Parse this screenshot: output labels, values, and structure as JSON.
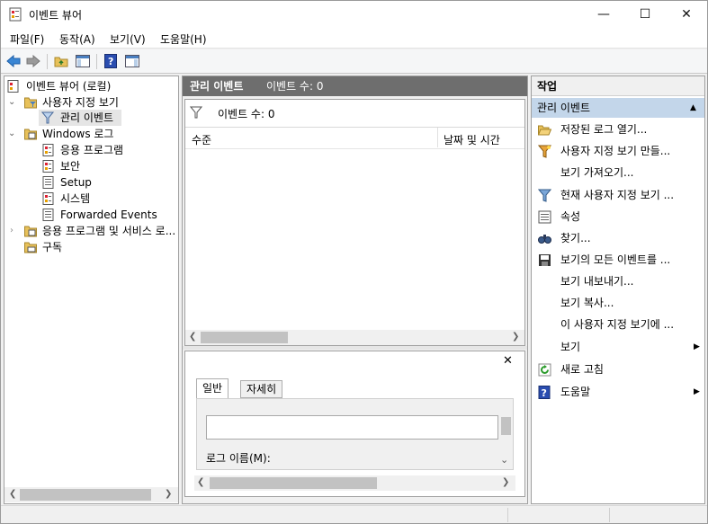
{
  "window": {
    "title": "이벤트 뷰어",
    "minimize": "—",
    "maximize": "☐",
    "close": "✕"
  },
  "menu": [
    "파일(F)",
    "동작(A)",
    "보기(V)",
    "도움말(H)"
  ],
  "tree": {
    "root": "이벤트 뷰어 (로컬)",
    "custom_views": "사용자 지정 보기",
    "admin_events": "관리 이벤트",
    "windows_logs": "Windows 로그",
    "logs": [
      "응용 프로그램",
      "보안",
      "Setup",
      "시스템",
      "Forwarded Events"
    ],
    "app_services": "응용 프로그램 및 서비스 로...",
    "subscriptions": "구독"
  },
  "center": {
    "header_title": "관리 이벤트",
    "header_count": "이벤트 수: 0",
    "filter_text": "이벤트 수: 0",
    "col_level": "수준",
    "col_date": "날짜 및 시간",
    "tab_general": "일반",
    "tab_details": "자세히",
    "log_name_label": "로그 이름(M):",
    "close_x": "✕"
  },
  "actions": {
    "header": "작업",
    "section": "관리 이벤트",
    "items": [
      {
        "label": "저장된 로그 열기...",
        "icon": "folder-open-icon"
      },
      {
        "label": "사용자 지정 보기 만들...",
        "icon": "filter-create-icon"
      },
      {
        "label": "보기 가져오기...",
        "icon": ""
      },
      {
        "label": "현재 사용자 지정 보기 ...",
        "icon": "filter-icon"
      },
      {
        "label": "속성",
        "icon": "properties-icon"
      },
      {
        "label": "찾기...",
        "icon": "binoculars-icon"
      },
      {
        "label": "보기의 모든 이벤트를 ...",
        "icon": "save-icon"
      },
      {
        "label": "보기 내보내기...",
        "icon": ""
      },
      {
        "label": "보기 복사...",
        "icon": ""
      },
      {
        "label": "이 사용자 지정 보기에 ...",
        "icon": ""
      },
      {
        "label": "보기",
        "icon": ""
      },
      {
        "label": "새로 고침",
        "icon": "refresh-icon"
      },
      {
        "label": "도움말",
        "icon": "help-icon"
      }
    ]
  },
  "colors": {
    "accent": "#0078d7",
    "section_bg": "#c3d6ea",
    "header_dark": "#6e6e6e"
  }
}
